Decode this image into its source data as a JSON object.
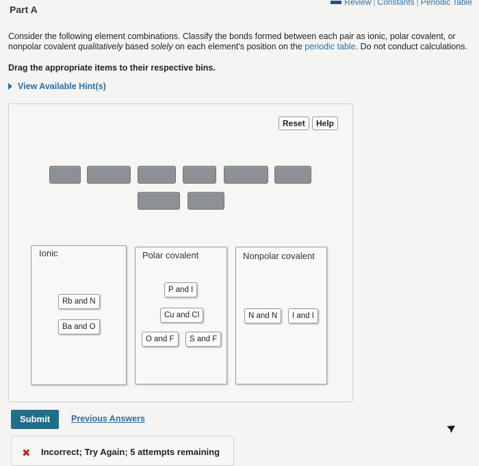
{
  "header": {
    "part_title": "Part A",
    "links": [
      "Review",
      "Constants",
      "Periodic Table"
    ]
  },
  "question": {
    "text_before": "Consider the following element combinations. Classify the bonds formed between each pair as ionic, polar covalent, or nonpolar covalent ",
    "text_em1": "qualitatively",
    "text_mid": " based ",
    "text_em2": "solely",
    "text_mid2": " on each element's position on the ",
    "link": "periodic table",
    "text_after": ". Do not conduct calculations.",
    "instruction": "Drag the appropriate items to their respective bins.",
    "hints": "View Available Hint(s)"
  },
  "controls": {
    "reset": "Reset",
    "help": "Help"
  },
  "bins": [
    {
      "label": "Ionic",
      "items": [
        "Rb and N",
        "Ba and O"
      ]
    },
    {
      "label": "Polar covalent",
      "items": [
        "P and I",
        "Cu and Cl",
        "O and F",
        "S and F"
      ]
    },
    {
      "label": "Nonpolar covalent",
      "items": [
        "N and N",
        "I and I"
      ]
    }
  ],
  "actions": {
    "submit": "Submit",
    "previous": "Previous Answers"
  },
  "feedback": {
    "icon": "✖",
    "text": "Incorrect; Try Again; 5 attempts remaining"
  },
  "colors": {
    "accent": "#1f6f8b",
    "link": "#2b6ea3",
    "error": "#c7261f",
    "slot": "#8d9195"
  }
}
